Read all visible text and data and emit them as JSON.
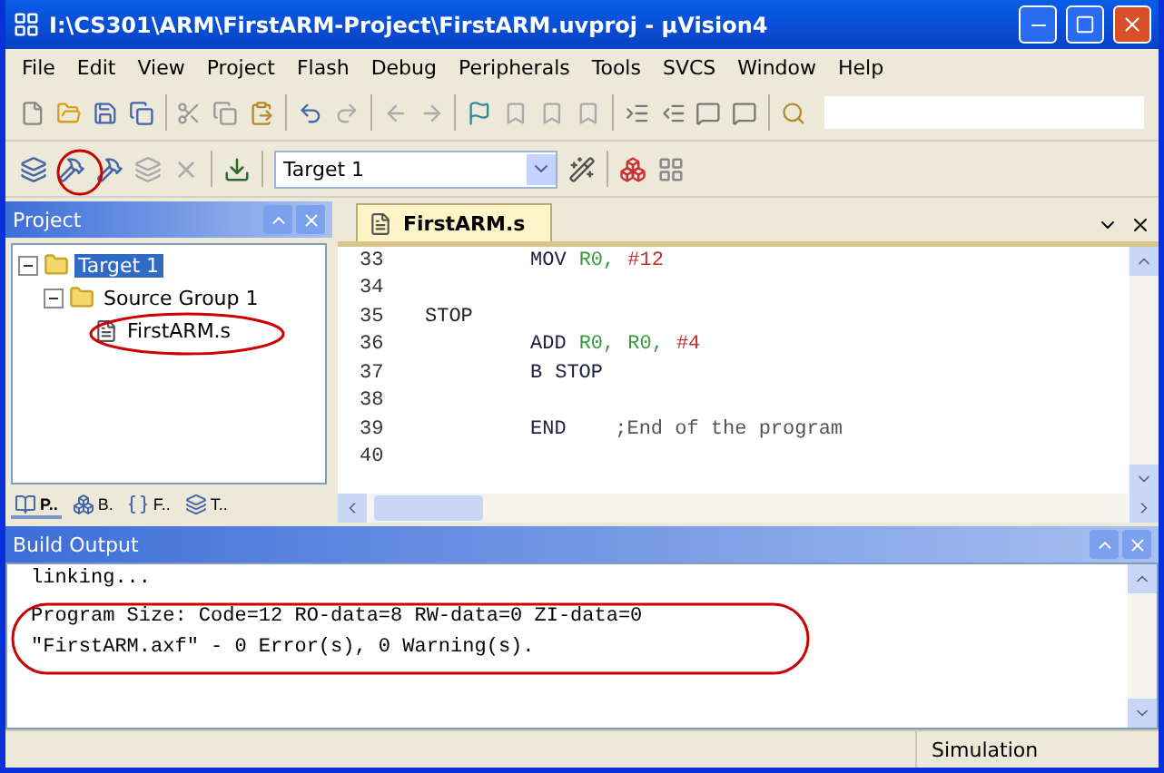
{
  "window": {
    "title": "I:\\CS301\\ARM\\FirstARM-Project\\FirstARM.uvproj - µVision4"
  },
  "menu": [
    "File",
    "Edit",
    "View",
    "Project",
    "Flash",
    "Debug",
    "Peripherals",
    "Tools",
    "SVCS",
    "Window",
    "Help"
  ],
  "build_toolbar": {
    "target": "Target 1"
  },
  "project_panel": {
    "title": "Project",
    "tree": [
      {
        "label": "Target 1",
        "selected": true,
        "expanded": true,
        "children": [
          {
            "label": "Source Group 1",
            "selected": false,
            "expanded": true,
            "children": [
              {
                "label": "FirstARM.s",
                "selected": false
              }
            ]
          }
        ]
      }
    ],
    "tabs": [
      {
        "label": "P..",
        "selected": true
      },
      {
        "label": "B.",
        "selected": false
      },
      {
        "label": "F..",
        "selected": false
      },
      {
        "label": "T..",
        "selected": false
      }
    ]
  },
  "editor": {
    "tab": "FirstARM.s",
    "lines": [
      {
        "number": "33",
        "tokens": [
          {
            "text": "MOV",
            "kind": "op"
          },
          {
            "text": "R0,",
            "kind": "reg"
          },
          {
            "text": "#12",
            "kind": "num"
          }
        ]
      },
      {
        "number": "34"
      },
      {
        "number": "35",
        "label": "STOP"
      },
      {
        "number": "36",
        "tokens": [
          {
            "text": "ADD",
            "kind": "op"
          },
          {
            "text": "R0,",
            "kind": "reg"
          },
          {
            "text": "R0,",
            "kind": "reg"
          },
          {
            "text": "#4",
            "kind": "num"
          }
        ]
      },
      {
        "number": "37",
        "tokens": [
          {
            "text": "B",
            "kind": "op"
          },
          {
            "text": "STOP",
            "kind": "op"
          }
        ]
      },
      {
        "number": "38"
      },
      {
        "number": "39",
        "tokens": [
          {
            "text": "END",
            "kind": "op"
          },
          {
            "text": "   ;End of the program",
            "kind": "comment"
          }
        ]
      },
      {
        "number": "40"
      }
    ]
  },
  "build_output": {
    "title": "Build Output",
    "lines": [
      "linking...",
      "Program Size: Code=12 RO-data=8 RW-data=0 ZI-data=0",
      "\"FirstARM.axf\" - 0 Error(s), 0 Warning(s)."
    ]
  },
  "status_bar": {
    "mode": "Simulation"
  }
}
